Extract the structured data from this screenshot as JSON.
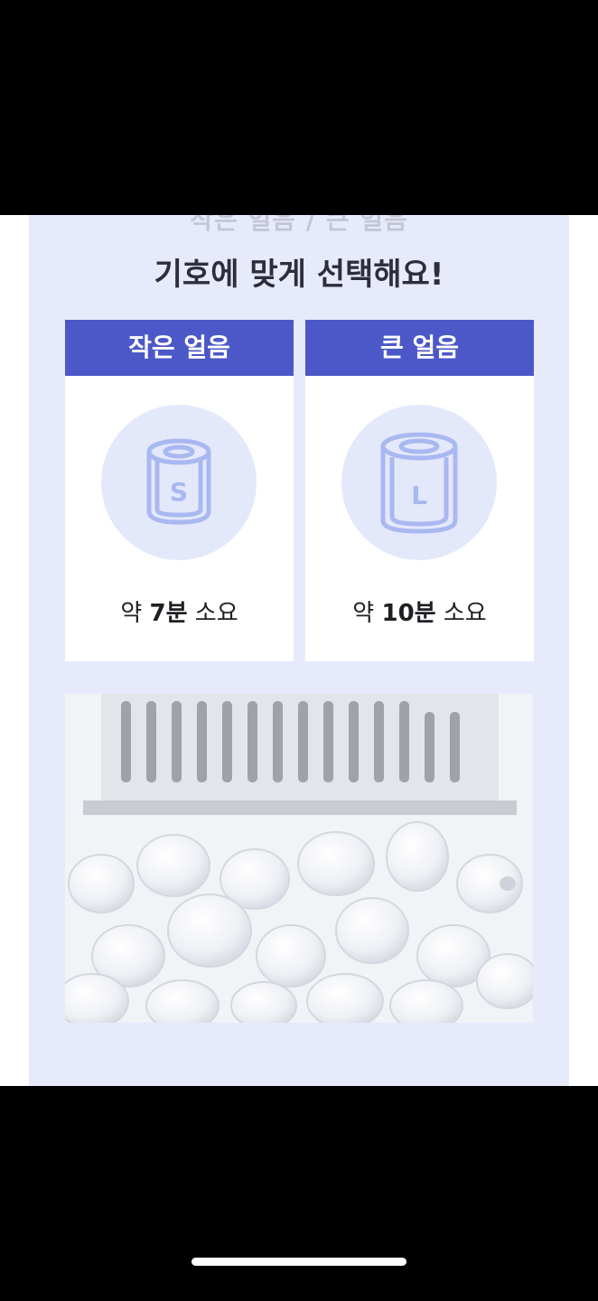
{
  "content": {
    "cut_heading": "작은 얼음 / 큰 얼음",
    "main_heading": "기호에 맞게 선택해요!",
    "cards": [
      {
        "title": "작은 얼음",
        "icon": "small-ice-cylinder-icon",
        "icon_letter": "S",
        "time_prefix": "약 ",
        "time_number": "7분",
        "time_suffix": " 소요"
      },
      {
        "title": "큰 얼음",
        "icon": "large-ice-cylinder-icon",
        "icon_letter": "L",
        "time_prefix": "약 ",
        "time_number": "10분",
        "time_suffix": " 소요"
      }
    ],
    "photo": "ice-basket-photo"
  },
  "colors": {
    "panel_bg": "#e7eafb",
    "header_blue": "#4c58c8",
    "icon_circle": "#e4e8fb",
    "icon_stroke": "#a9b8f0",
    "heading_text": "#2d2e3a"
  }
}
